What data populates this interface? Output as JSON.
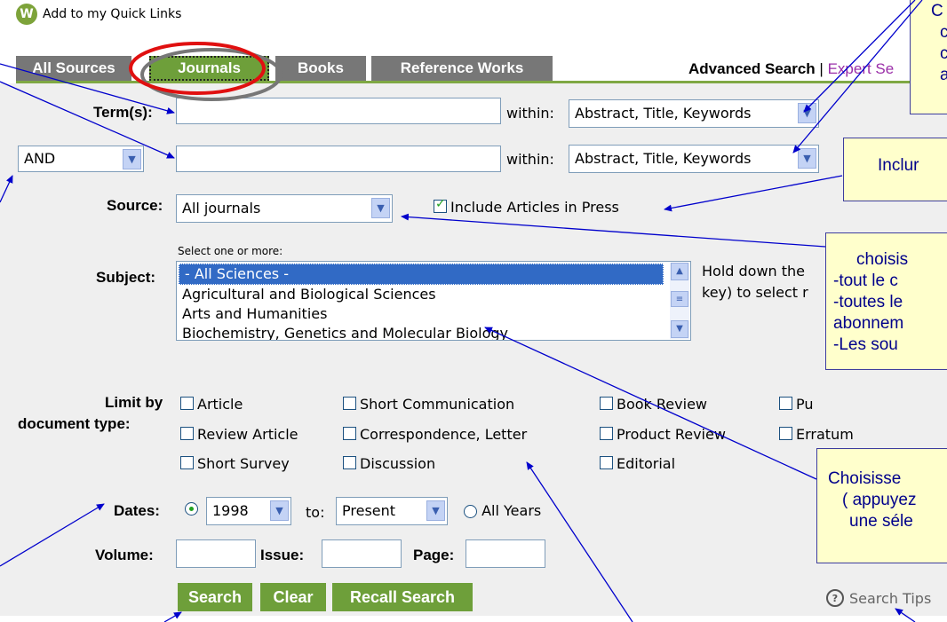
{
  "header": {
    "quicklinks_label": "Add to my Quick Links"
  },
  "tabs": [
    {
      "label": "All Sources"
    },
    {
      "label": "Journals"
    },
    {
      "label": "Books"
    },
    {
      "label": "Reference Works"
    }
  ],
  "search_modes": {
    "advanced": "Advanced Search",
    "separator": "|",
    "expert": "Expert Se"
  },
  "form": {
    "terms_label": "Term(s):",
    "term1_value": "",
    "term2_value": "",
    "within_label": "within:",
    "within1_value": "Abstract, Title, Keywords",
    "within2_value": "Abstract, Title, Keywords",
    "operator_value": "AND",
    "source_label": "Source:",
    "source_value": "All journals",
    "include_press_label": "Include Articles in Press",
    "select_hint": "Select one or more:",
    "subject_label": "Subject:",
    "subjects": [
      "- All Sciences -",
      "Agricultural and Biological Sciences",
      "Arts and Humanities",
      "Biochemistry, Genetics and Molecular Biology"
    ],
    "hold_down_line1": "Hold down the",
    "hold_down_line2": "key) to select r",
    "limit_label_1": "Limit by",
    "limit_label_2": "document type:",
    "doc_types": {
      "article": "Article",
      "short_communication": "Short Communication",
      "book_review": "Book Review",
      "pu": "Pu",
      "review_article": "Review Article",
      "correspondence": "Correspondence, Letter",
      "product_review": "Product Review",
      "erratum": "Erratum",
      "short_survey": "Short Survey",
      "discussion": "Discussion",
      "editorial": "Editorial"
    },
    "dates_label": "Dates:",
    "from_year": "1998",
    "to_label": "to:",
    "to_value": "Present",
    "all_years_label": "All Years",
    "volume_label": "Volume:",
    "issue_label": "Issue:",
    "page_label": "Page:"
  },
  "buttons": {
    "search": "Search",
    "clear": "Clear",
    "recall": "Recall Search"
  },
  "search_tips": "Search Tips",
  "callouts": {
    "c1_line1": "C",
    "c1_line2": "c",
    "c1_line3": "c",
    "c1_line4": "a",
    "c2": "Inclur",
    "c3_line1": "choisis",
    "c3_line2": "-tout le c",
    "c3_line3": "-toutes le",
    "c3_line4": "abonnem",
    "c3_line5": "-Les sou",
    "c4_line1": "Choisisse",
    "c4_line2": "( appuyez",
    "c4_line3": "une séle"
  },
  "colors": {
    "tab_green": "#6e9f3a",
    "tab_grey": "#777777",
    "annotation_blue": "#0000cc",
    "callout_fill": "#ffffcc",
    "highlight_red": "#e01010"
  }
}
